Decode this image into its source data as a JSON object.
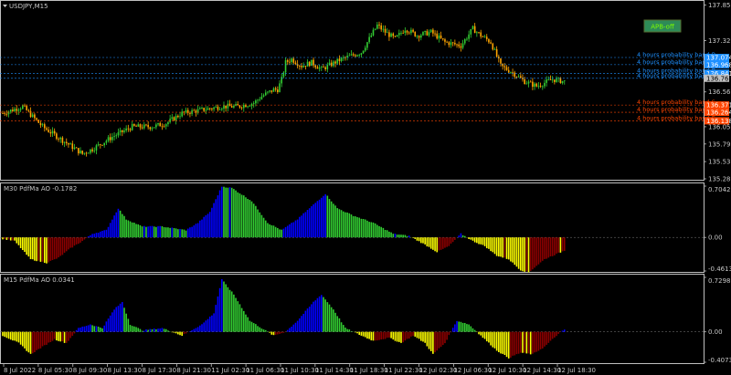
{
  "main": {
    "title": "USDJPY,M15",
    "apb_button": "APB-off",
    "price_ticks": [
      "137.850",
      "137.325",
      "136.565",
      "136.050",
      "135.795",
      "135.535",
      "135.280"
    ],
    "price_range": [
      135.28,
      137.87
    ],
    "bands": [
      {
        "label": "4 hours probability band R",
        "value": "137.074",
        "color": "#1e90ff",
        "price": 137.074
      },
      {
        "label": "4 hours probability band R",
        "value": "136.968",
        "color": "#1e90ff",
        "price": 136.968
      },
      {
        "label": "4 hours probability band R",
        "value": "136.841",
        "color": "#1e90ff",
        "price": 136.841
      },
      {
        "label": "4 hours probability band P",
        "value": "136.767",
        "color": "#1e90ff",
        "price": 136.767
      },
      {
        "label": "4 hours probability band S",
        "value": "136.371",
        "color": "#ff4500",
        "price": 136.371
      },
      {
        "label": "4 hours probability band S",
        "value": "136.264",
        "color": "#ff4500",
        "price": 136.264
      },
      {
        "label": "4 hours probability band S",
        "value": "136.138",
        "color": "#ff4500",
        "price": 136.138
      }
    ],
    "current_price": "136.767"
  },
  "sub1": {
    "title": "M30 PdfMa AO -0.1782",
    "ticks": [
      "0.7042",
      "0.00",
      "-0.4613"
    ],
    "range": [
      -0.4613,
      0.7042
    ]
  },
  "sub2": {
    "title": "M15 PdfMa AO 0.0341",
    "ticks": [
      "0.7298",
      "0.00",
      "-0.4073"
    ],
    "range": [
      -0.4073,
      0.7298
    ]
  },
  "time_axis": [
    "8 Jul 2022",
    "8 Jul 05:30",
    "8 Jul 09:30",
    "8 Jul 13:30",
    "8 Jul 17:30",
    "8 Jul 21:30",
    "11 Jul 02:30",
    "11 Jul 06:30",
    "11 Jul 10:30",
    "11 Jul 14:30",
    "11 Jul 18:30",
    "11 Jul 22:30",
    "12 Jul 02:30",
    "12 Jul 06:30",
    "12 Jul 10:30",
    "12 Jul 14:30",
    "12 Jul 18:30"
  ],
  "colors": {
    "bull": "#32cd32",
    "bear": "#ffa500",
    "ao_up": "#0000ff",
    "ao_green": "#32cd32",
    "ao_down": "#ffff00",
    "ao_red": "#8b0000",
    "grid": "#c0c0c0"
  },
  "chart_data": [
    {
      "type": "candlestick",
      "title": "USDJPY,M15",
      "anchor_prices": [
        [
          0,
          136.25
        ],
        [
          10,
          136.35
        ],
        [
          20,
          136.05
        ],
        [
          30,
          135.85
        ],
        [
          40,
          135.65
        ],
        [
          45,
          135.72
        ],
        [
          55,
          135.9
        ],
        [
          65,
          136.05
        ],
        [
          75,
          136.05
        ],
        [
          82,
          136.1
        ],
        [
          90,
          136.25
        ],
        [
          100,
          136.3
        ],
        [
          110,
          136.35
        ],
        [
          118,
          136.35
        ],
        [
          126,
          136.4
        ],
        [
          130,
          136.5
        ],
        [
          133,
          136.55
        ],
        [
          136,
          136.6
        ],
        [
          138,
          136.6
        ],
        [
          140,
          136.75
        ],
        [
          142,
          137.0
        ],
        [
          145,
          137.05
        ],
        [
          150,
          136.95
        ],
        [
          155,
          137.0
        ],
        [
          160,
          136.9
        ],
        [
          170,
          137.05
        ],
        [
          180,
          137.15
        ],
        [
          188,
          137.55
        ],
        [
          192,
          137.45
        ],
        [
          197,
          137.35
        ],
        [
          202,
          137.5
        ],
        [
          208,
          137.4
        ],
        [
          215,
          137.45
        ],
        [
          222,
          137.3
        ],
        [
          230,
          137.25
        ],
        [
          236,
          137.5
        ],
        [
          240,
          137.4
        ],
        [
          245,
          137.3
        ],
        [
          250,
          136.95
        ],
        [
          256,
          136.85
        ],
        [
          262,
          136.72
        ],
        [
          268,
          136.65
        ],
        [
          276,
          136.75
        ],
        [
          282,
          136.72
        ]
      ],
      "y_range": [
        135.28,
        137.87
      ]
    },
    {
      "type": "bar",
      "title": "M30 PdfMa AO -0.1782",
      "anchor_values": [
        [
          0,
          -0.02
        ],
        [
          6,
          -0.05
        ],
        [
          14,
          -0.3
        ],
        [
          22,
          -0.35
        ],
        [
          28,
          -0.28
        ],
        [
          34,
          -0.15
        ],
        [
          40,
          -0.05
        ],
        [
          45,
          0.05
        ],
        [
          52,
          0.1
        ],
        [
          58,
          0.4
        ],
        [
          62,
          0.25
        ],
        [
          70,
          0.15
        ],
        [
          80,
          0.15
        ],
        [
          92,
          0.1
        ],
        [
          98,
          0.2
        ],
        [
          104,
          0.35
        ],
        [
          110,
          0.7
        ],
        [
          115,
          0.68
        ],
        [
          125,
          0.5
        ],
        [
          133,
          0.2
        ],
        [
          140,
          0.1
        ],
        [
          148,
          0.25
        ],
        [
          156,
          0.45
        ],
        [
          162,
          0.6
        ],
        [
          168,
          0.4
        ],
        [
          176,
          0.3
        ],
        [
          186,
          0.2
        ],
        [
          196,
          0.05
        ],
        [
          204,
          0.02
        ],
        [
          212,
          -0.1
        ],
        [
          218,
          -0.2
        ],
        [
          224,
          -0.12
        ],
        [
          230,
          0.05
        ],
        [
          236,
          -0.05
        ],
        [
          242,
          -0.12
        ],
        [
          248,
          -0.25
        ],
        [
          254,
          -0.3
        ],
        [
          260,
          -0.45
        ],
        [
          264,
          -0.48
        ],
        [
          272,
          -0.3
        ],
        [
          282,
          -0.18
        ]
      ],
      "y_range": [
        -0.4613,
        0.7042
      ]
    },
    {
      "type": "bar",
      "title": "M15 PdfMa AO 0.0341",
      "anchor_values": [
        [
          0,
          -0.05
        ],
        [
          8,
          -0.15
        ],
        [
          14,
          -0.3
        ],
        [
          20,
          -0.2
        ],
        [
          26,
          -0.1
        ],
        [
          32,
          -0.15
        ],
        [
          38,
          0.05
        ],
        [
          44,
          0.1
        ],
        [
          50,
          0.05
        ],
        [
          56,
          0.3
        ],
        [
          60,
          0.4
        ],
        [
          64,
          0.1
        ],
        [
          70,
          0.02
        ],
        [
          80,
          0.05
        ],
        [
          90,
          -0.05
        ],
        [
          100,
          0.1
        ],
        [
          106,
          0.25
        ],
        [
          110,
          0.7
        ],
        [
          116,
          0.5
        ],
        [
          124,
          0.15
        ],
        [
          130,
          0.05
        ],
        [
          136,
          -0.05
        ],
        [
          142,
          0.0
        ],
        [
          148,
          0.15
        ],
        [
          156,
          0.4
        ],
        [
          160,
          0.5
        ],
        [
          166,
          0.3
        ],
        [
          172,
          0.05
        ],
        [
          180,
          -0.05
        ],
        [
          186,
          -0.12
        ],
        [
          194,
          -0.08
        ],
        [
          200,
          -0.15
        ],
        [
          206,
          -0.05
        ],
        [
          212,
          -0.15
        ],
        [
          216,
          -0.3
        ],
        [
          222,
          -0.15
        ],
        [
          228,
          0.15
        ],
        [
          234,
          0.1
        ],
        [
          240,
          -0.05
        ],
        [
          248,
          -0.25
        ],
        [
          254,
          -0.35
        ],
        [
          260,
          -0.28
        ],
        [
          266,
          -0.3
        ],
        [
          272,
          -0.2
        ],
        [
          278,
          -0.05
        ],
        [
          282,
          0.03
        ]
      ],
      "y_range": [
        -0.4073,
        0.7298
      ]
    }
  ]
}
